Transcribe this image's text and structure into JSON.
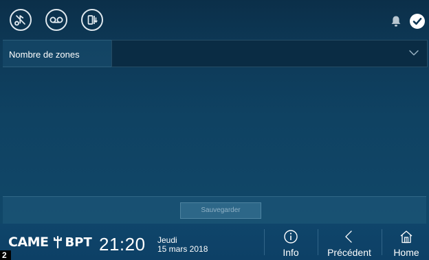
{
  "header": {
    "icons": [
      "music-note-icon",
      "voicemail-icon",
      "door-icon"
    ],
    "status_icons": [
      "bell-icon",
      "check-icon"
    ]
  },
  "zones": {
    "label": "Nombre de zones",
    "value": ""
  },
  "actions": {
    "save_label": "Sauvegarder"
  },
  "footer": {
    "brand_left": "CAME",
    "brand_right": "BPT",
    "time": "21:20",
    "day": "Jeudi",
    "date": "15 mars 2018",
    "nav": {
      "info": "Info",
      "previous": "Précédent",
      "home": "Home"
    }
  },
  "corner_label": "2",
  "colors": {
    "background": "#0f4262",
    "select_bg": "#0a2c44",
    "text": "#ffffff"
  }
}
